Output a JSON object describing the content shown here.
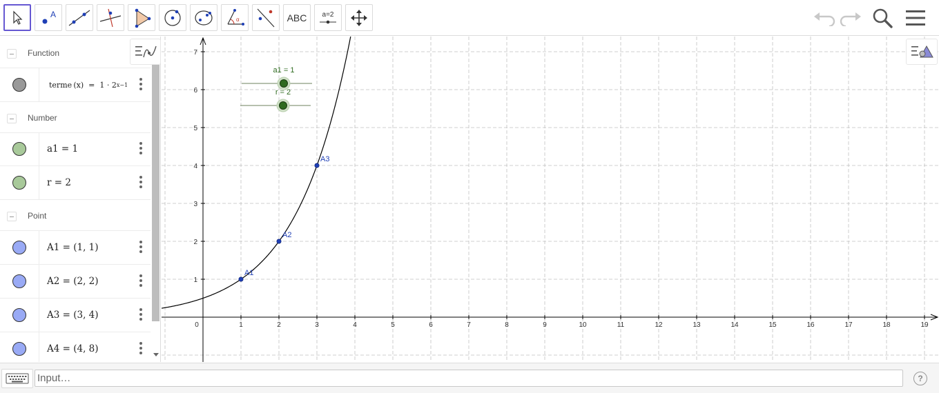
{
  "toolbar": {
    "tools": [
      {
        "name": "move-tool",
        "icon": "arrow-cursor-icon"
      },
      {
        "name": "point-tool",
        "icon": "point-icon"
      },
      {
        "name": "line-tool",
        "icon": "line-through-two-points-icon"
      },
      {
        "name": "perpendicular-line-tool",
        "icon": "perpendicular-line-icon"
      },
      {
        "name": "polygon-tool",
        "icon": "polygon-icon"
      },
      {
        "name": "circle-tool",
        "icon": "circle-center-point-icon"
      },
      {
        "name": "ellipse-tool",
        "icon": "ellipse-icon"
      },
      {
        "name": "angle-tool",
        "icon": "angle-icon"
      },
      {
        "name": "reflect-tool",
        "icon": "reflect-about-line-icon"
      },
      {
        "name": "text-tool",
        "label": "ABC"
      },
      {
        "name": "slider-tool",
        "label": "a=2"
      },
      {
        "name": "move-graphics-tool",
        "icon": "move-graphics-icon"
      }
    ],
    "active_tool": "move-tool",
    "undo_icon": "undo-icon",
    "redo_icon": "redo-icon",
    "search_icon": "search-icon",
    "menu_icon": "hamburger-menu-icon",
    "active_color": "#6557d2"
  },
  "algebra": {
    "groups": {
      "function": "Function",
      "number": "Number",
      "point": "Point"
    },
    "function_row": {
      "name": "terme",
      "var": "x",
      "a1": "1",
      "base": "2",
      "exponent": "x−1",
      "color": "#999999"
    },
    "number_rows": [
      {
        "label": "a1 = 1",
        "color": "#a8c99a"
      },
      {
        "label": "r = 2",
        "color": "#a8c99a"
      }
    ],
    "point_rows": [
      {
        "label": "A1 = (1, 1)",
        "color": "#99aaf5"
      },
      {
        "label": "A2 = (2, 2)",
        "color": "#99aaf5"
      },
      {
        "label": "A3 = (3, 4)",
        "color": "#99aaf5"
      },
      {
        "label": "A4 = (4, 8)",
        "color": "#99aaf5"
      }
    ]
  },
  "graphics": {
    "x_ticks": [
      "0",
      "1",
      "2",
      "3",
      "4",
      "5",
      "6",
      "7",
      "8",
      "9",
      "10",
      "11",
      "12",
      "13",
      "14",
      "15",
      "16",
      "17",
      "18",
      "19"
    ],
    "y_ticks": [
      "1",
      "2",
      "3",
      "4",
      "5",
      "6",
      "7"
    ],
    "axis_color": "#000000",
    "grid_color": "#c0c0c0",
    "curve_color": "#000000",
    "point_color": "#1f3fb5",
    "slider_color": "#2f6b20",
    "points": [
      {
        "label": "A1",
        "x": 1,
        "y": 1
      },
      {
        "label": "A2",
        "x": 2,
        "y": 2
      },
      {
        "label": "A3",
        "x": 3,
        "y": 4
      }
    ],
    "sliders": [
      {
        "label": "a1 = 1",
        "value": 1
      },
      {
        "label": "r = 2",
        "value": 2
      }
    ]
  },
  "input": {
    "placeholder": "Input…",
    "keyboard_icon": "keyboard-icon",
    "help_label": "?"
  }
}
